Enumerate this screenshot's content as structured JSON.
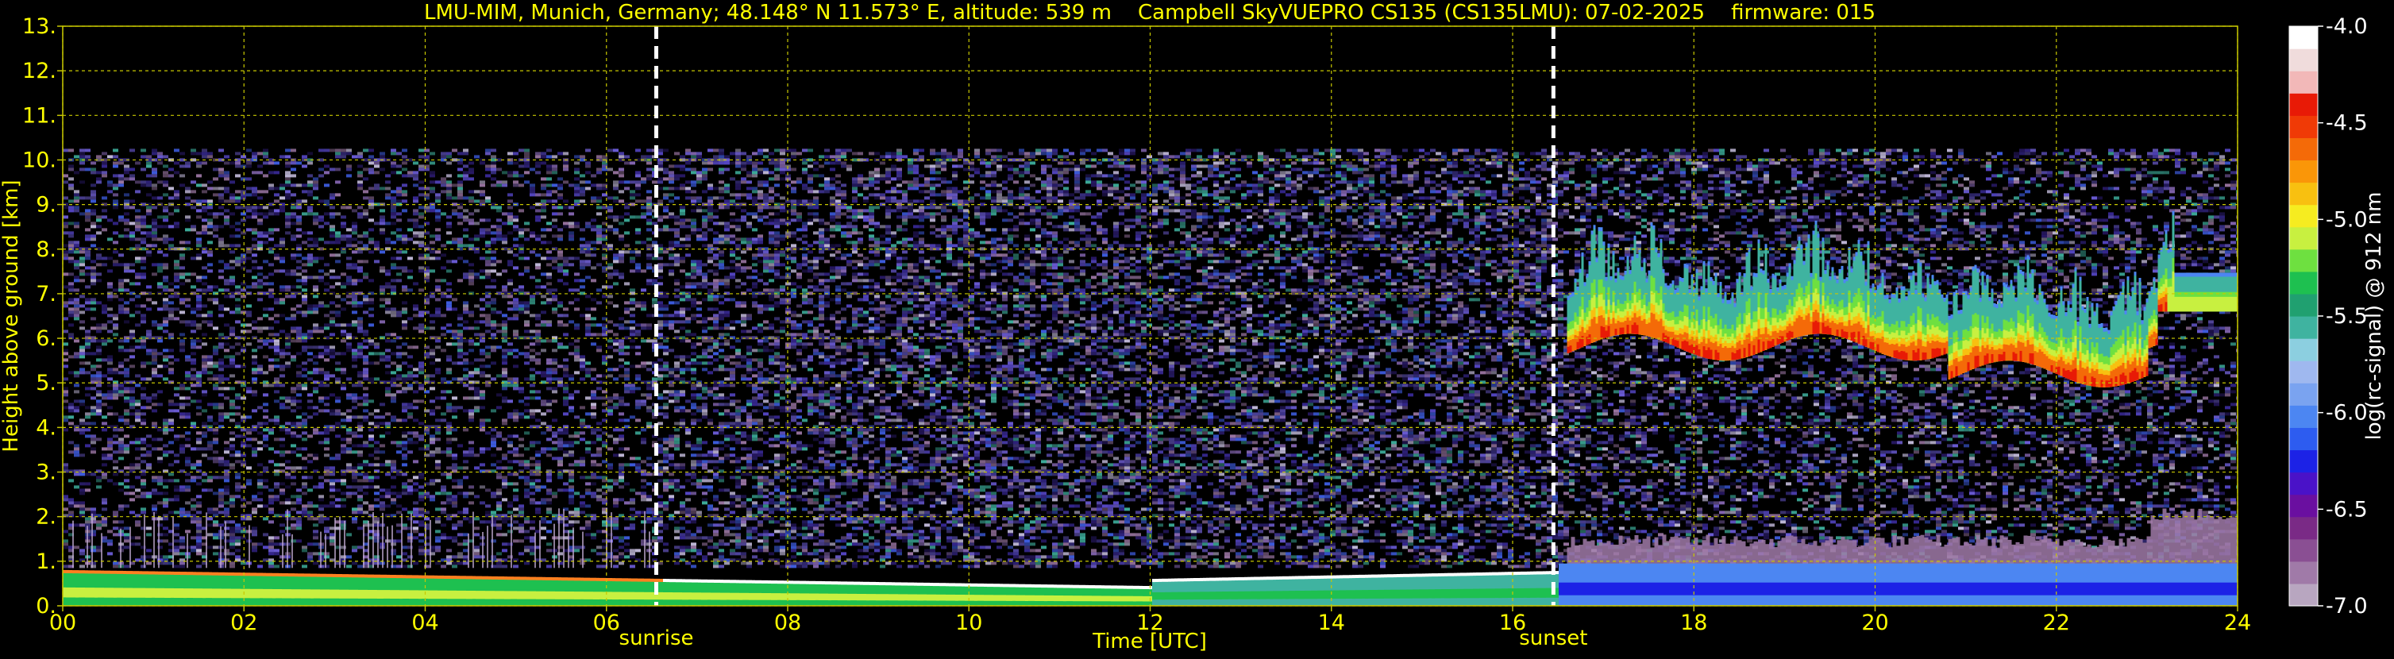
{
  "chart_data": {
    "type": "heatmap",
    "title": "LMU-MIM, Munich, Germany; 48.148° N 11.573° E, altitude: 539 m    Campbell SkyVUEPRO CS135 (CS135LMU): 07-02-2025    firmware: 015",
    "xlabel": "Time [UTC]",
    "ylabel": "Height above ground [km]",
    "xlim": [
      0,
      24
    ],
    "ylim": [
      0,
      13
    ],
    "x_ticks": [
      "00",
      "02",
      "04",
      "06",
      "08",
      "10",
      "12",
      "14",
      "16",
      "18",
      "20",
      "22",
      "24"
    ],
    "y_ticks": [
      "0.",
      "1.",
      "2.",
      "3.",
      "4.",
      "5.",
      "6.",
      "7.",
      "8.",
      "9.",
      "10.",
      "11.",
      "12.",
      "13."
    ],
    "grid": true,
    "markers": [
      {
        "label": "sunrise",
        "x": 6.55
      },
      {
        "label": "sunset",
        "x": 16.45
      }
    ],
    "colorbar": {
      "label": "log(rc-signal) @ 912 nm",
      "min": -7.0,
      "max": -4.0,
      "ticks": [
        "-4.0",
        "-4.5",
        "-5.0",
        "-5.5",
        "-6.0",
        "-6.5",
        "-7.0"
      ],
      "colors": [
        "#b8a6c0",
        "#a07aa8",
        "#8a4f93",
        "#7a2a86",
        "#6a0fa0",
        "#4a12c8",
        "#1c22e6",
        "#2d5cf0",
        "#4c86f2",
        "#7aa3f0",
        "#9fb8ef",
        "#8ccfe0",
        "#3fb3a0",
        "#20a070",
        "#1ec050",
        "#6ee040",
        "#c8f040",
        "#f6ec20",
        "#f8c010",
        "#fa9608",
        "#f46a08",
        "#f03a06",
        "#e81a06",
        "#f2b8b8",
        "#f0dcdc",
        "#ffffff"
      ]
    },
    "layers": [
      {
        "name": "noise_region",
        "x": [
          0,
          24
        ],
        "y": [
          0.9,
          10.25
        ]
      },
      {
        "name": "cloud_layer",
        "x": [
          16.6,
          24
        ],
        "y": [
          5.2,
          9.2
        ],
        "peak_value": -4.7
      },
      {
        "name": "boundary_layer",
        "x": [
          0,
          24
        ],
        "y": [
          0.0,
          1.6
        ]
      }
    ]
  },
  "colors": {
    "text": "#ffff00",
    "grid": "#c8c800",
    "marker": "#ffffff",
    "background": "#000000",
    "colorbar_text": "#ffffff"
  }
}
